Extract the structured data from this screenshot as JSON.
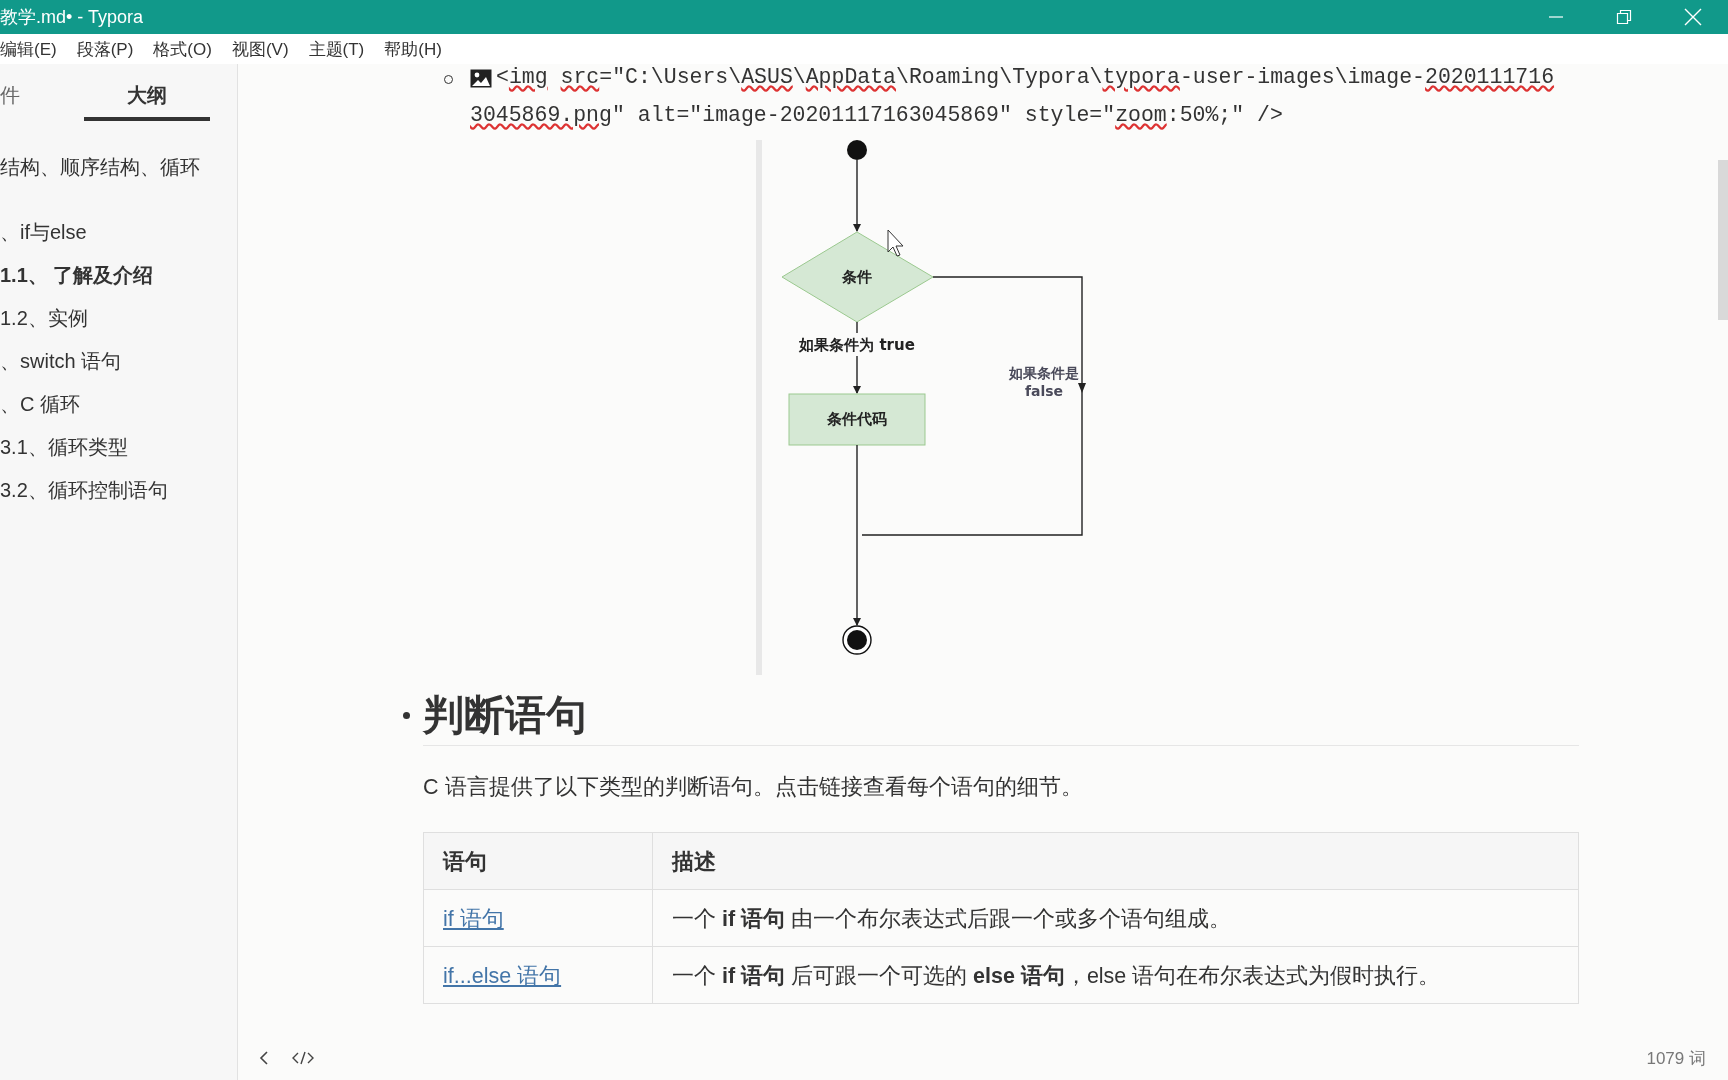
{
  "window": {
    "title": "教学.md• - Typora"
  },
  "menu": [
    "编辑(E)",
    "段落(P)",
    "格式(O)",
    "视图(V)",
    "主题(T)",
    "帮助(H)"
  ],
  "sidebar": {
    "tabs": [
      {
        "label": "件",
        "selected": false
      },
      {
        "label": "大纲",
        "selected": true
      }
    ],
    "outline": [
      {
        "label": "结构、顺序结构、循环",
        "selected": false,
        "children": [
          {
            "label": "、if与else",
            "selected": false,
            "children": [
              {
                "label": "1.1、 了解及介绍",
                "selected": true
              },
              {
                "label": "1.2、实例",
                "selected": false
              }
            ]
          },
          {
            "label": "、switch 语句",
            "selected": false
          },
          {
            "label": "、C 循环",
            "selected": false,
            "children": [
              {
                "label": "3.1、循环类型",
                "selected": false
              },
              {
                "label": "3.2、循环控制语句",
                "selected": false
              }
            ]
          }
        ]
      }
    ]
  },
  "code_lines": [
    [
      {
        "text": "<",
        "misspelled": false
      },
      {
        "text": "img",
        "misspelled": true
      },
      {
        "text": "src",
        "misspelled": true,
        "space_before": true
      },
      {
        "text": "=\"C:\\Users\\",
        "misspelled": false
      },
      {
        "text": "ASUS",
        "misspelled": true
      },
      {
        "text": "\\",
        "misspelled": false
      },
      {
        "text": "AppData",
        "misspelled": true
      },
      {
        "text": "\\Roaming\\Typora\\",
        "misspelled": false
      },
      {
        "text": "typora",
        "misspelled": true
      },
      {
        "text": "-user-images\\image-",
        "misspelled": false
      },
      {
        "text": "2020111716",
        "misspelled": true
      }
    ],
    [
      {
        "text": "3045869.png",
        "misspelled": true
      },
      {
        "text": "\" alt=\"image-20201117163045869\" style=\"",
        "misspelled": false
      },
      {
        "text": "zoom",
        "misspelled": true
      },
      {
        "text": ":50%;\" />",
        "misspelled": false
      }
    ]
  ],
  "flowchart": {
    "decision": "条件",
    "true_label": "如果条件为 true",
    "process": "条件代码",
    "false_label": [
      "如果条件是",
      "false"
    ]
  },
  "heading": "判断语句",
  "intro": "C 语言提供了以下类型的判断语句。点击链接查看每个语句的细节。",
  "table": {
    "columns": [
      "语句",
      "描述"
    ],
    "rows": [
      {
        "statement": "if 语句",
        "description": "一个 **if 语句** 由一个布尔表达式后跟一个或多个语句组成。"
      },
      {
        "statement": "if...else 语句",
        "description": "一个 **if 语句** 后可跟一个可选的 **else 语句**，else 语句在布尔表达式为假时执行。"
      }
    ]
  },
  "status_bar": {
    "word_count": "1079 词"
  }
}
